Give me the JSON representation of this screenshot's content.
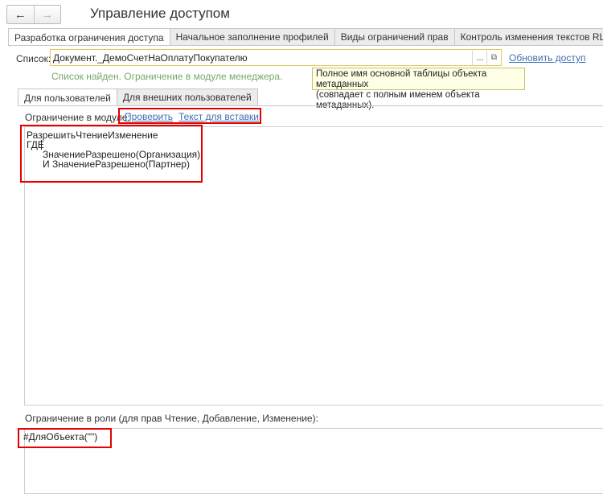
{
  "header": {
    "title": "Управление доступом",
    "back_icon": "←",
    "forward_icon": "→"
  },
  "tabs_top": [
    {
      "label": "Разработка ограничения доступа",
      "active": true
    },
    {
      "label": "Начальное заполнение профилей",
      "active": false
    },
    {
      "label": "Виды ограничений прав",
      "active": false
    },
    {
      "label": "Контроль изменения текстов RLS",
      "active": false
    }
  ],
  "list": {
    "label": "Список:",
    "value": "Документ._ДемоСчетНаОплатуПокупателю",
    "select_button": "...",
    "open_button": "⧉",
    "refresh_link": "Обновить доступ",
    "status": "Список найден. Ограничение в модуле менеджера.",
    "tooltip_line1": "Полное имя основной таблицы объекта метаданных",
    "tooltip_line2": "(совпадает с полным именем объекта метаданных)."
  },
  "tabs_inner": [
    {
      "label": "Для пользователей",
      "active": true
    },
    {
      "label": "Для внешних пользователей",
      "active": false
    }
  ],
  "module": {
    "label": "Ограничение в модуле:",
    "check_link": "Проверить",
    "insert_link": "Текст для вставки",
    "code": [
      "РазрешитьЧтениеИзменение",
      "ГДЕ",
      "ЗначениеРазрешено(Организация)",
      "И ЗначениеРазрешено(Партнер)"
    ]
  },
  "role": {
    "label": "Ограничение в роли (для прав Чтение, Добавление, Изменение):",
    "code": "#ДляОбъекта(\"\")"
  },
  "colors": {
    "highlight": "#e60000",
    "link": "#3f6fb2",
    "status": "#7aa66a",
    "field_border": "#e0c85a",
    "tooltip_bg": "#ffffe6"
  }
}
